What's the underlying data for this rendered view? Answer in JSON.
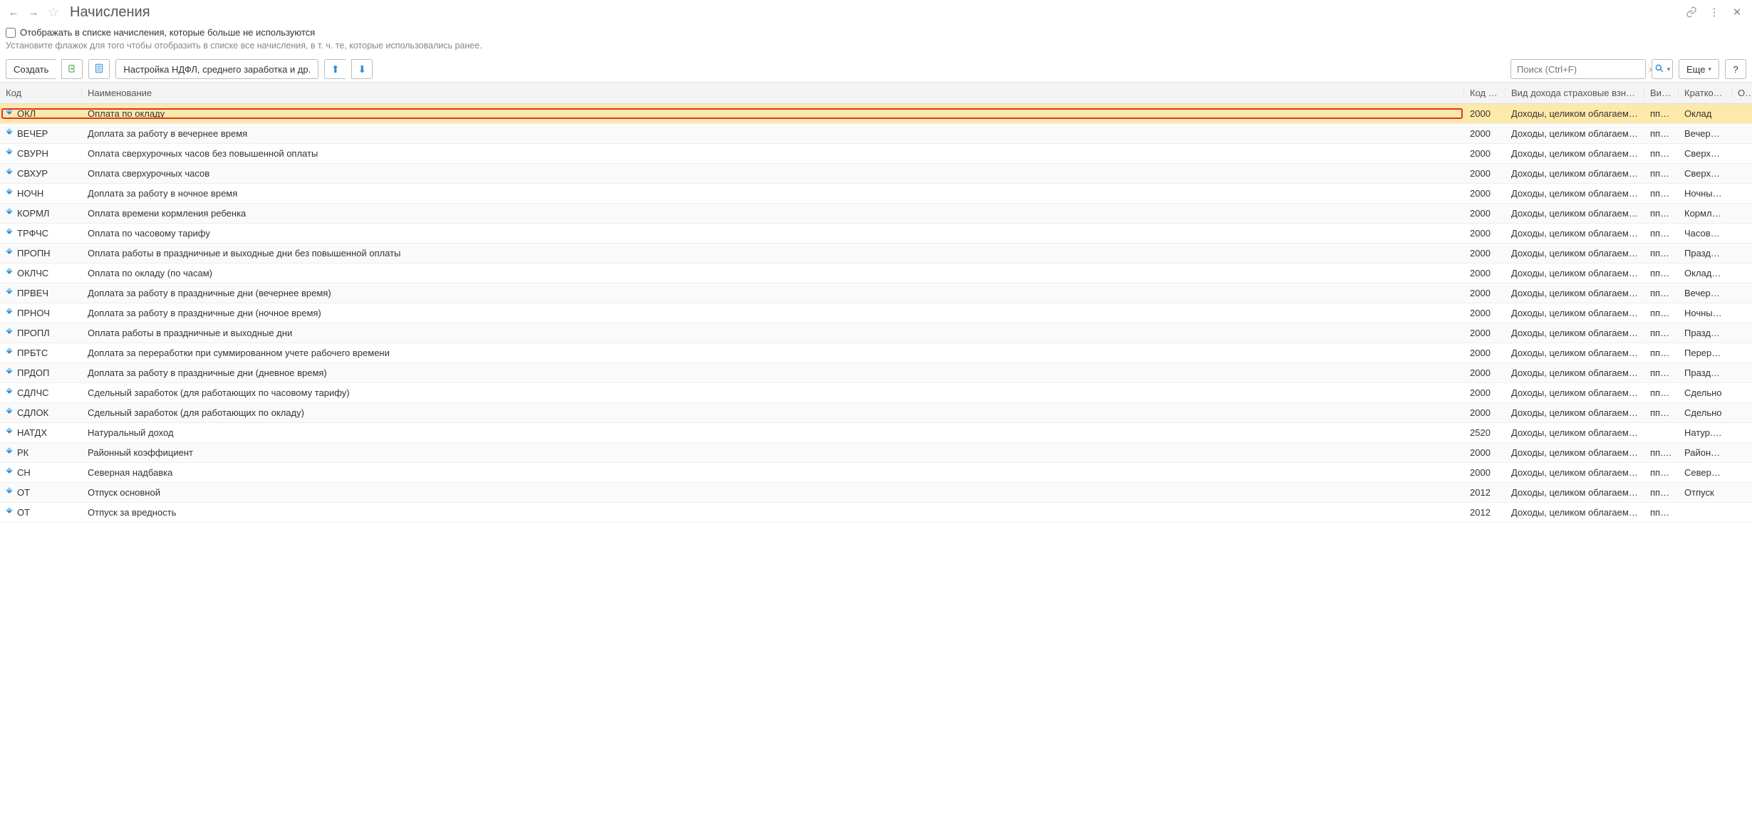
{
  "header": {
    "title": "Начисления"
  },
  "checkbox": {
    "label": "Отображать в списке начисления, которые больше не используются"
  },
  "hint": "Установите флажок для того чтобы отобразить в списке все начисления, в т. ч. те, которые использовались ранее.",
  "toolbar": {
    "create": "Создать",
    "settings": "Настройка НДФЛ, среднего заработка и др.",
    "more": "Еще",
    "search_placeholder": "Поиск (Ctrl+F)"
  },
  "columns": {
    "code": "Код",
    "name": "Наименование",
    "kod2": "Код …",
    "income": "Вид дохода страховые взносы",
    "vid": "Вид…",
    "short": "Кратко…",
    "o": "О…"
  },
  "rows": [
    {
      "code": "ОКЛ",
      "name": "Оплата по окладу",
      "k": "2000",
      "inc": "Доходы, целиком облагаемы…",
      "v": "пп…",
      "s": "Оклад",
      "selected": true,
      "highlight": true
    },
    {
      "code": "ВЕЧЕР",
      "name": "Доплата за работу в вечернее время",
      "k": "2000",
      "inc": "Доходы, целиком облагаемы…",
      "v": "пп…",
      "s": "Вечер…"
    },
    {
      "code": "СВУРН",
      "name": "Оплата сверхурочных часов без повышенной оплаты",
      "k": "2000",
      "inc": "Доходы, целиком облагаемы…",
      "v": "пп…",
      "s": "Сверх…"
    },
    {
      "code": "СВХУР",
      "name": "Оплата сверхурочных часов",
      "k": "2000",
      "inc": "Доходы, целиком облагаемы…",
      "v": "пп…",
      "s": "Сверх…"
    },
    {
      "code": "НОЧН",
      "name": "Доплата за работу в ночное время",
      "k": "2000",
      "inc": "Доходы, целиком облагаемы…",
      "v": "пп…",
      "s": "Ночны…"
    },
    {
      "code": "КОРМЛ",
      "name": "Оплата времени кормления ребенка",
      "k": "2000",
      "inc": "Доходы, целиком облагаемы…",
      "v": "пп…",
      "s": "Кормл…"
    },
    {
      "code": "ТРФЧС",
      "name": "Оплата по часовому тарифу",
      "k": "2000",
      "inc": "Доходы, целиком облагаемы…",
      "v": "пп…",
      "s": "Часов…"
    },
    {
      "code": "ПРОПН",
      "name": "Оплата работы в праздничные и выходные дни без повышенной оплаты",
      "k": "2000",
      "inc": "Доходы, целиком облагаемы…",
      "v": "пп…",
      "s": "Празд…"
    },
    {
      "code": "ОКЛЧС",
      "name": "Оплата по окладу (по часам)",
      "k": "2000",
      "inc": "Доходы, целиком облагаемы…",
      "v": "пп…",
      "s": "Оклад…"
    },
    {
      "code": "ПРВЕЧ",
      "name": "Доплата за работу в праздничные дни (вечернее время)",
      "k": "2000",
      "inc": "Доходы, целиком облагаемы…",
      "v": "пп…",
      "s": "Вечер…"
    },
    {
      "code": "ПРНОЧ",
      "name": "Доплата за работу в праздничные дни (ночное время)",
      "k": "2000",
      "inc": "Доходы, целиком облагаемы…",
      "v": "пп…",
      "s": "Ночны…"
    },
    {
      "code": "ПРОПЛ",
      "name": "Оплата работы в праздничные и выходные дни",
      "k": "2000",
      "inc": "Доходы, целиком облагаемы…",
      "v": "пп…",
      "s": "Празд…"
    },
    {
      "code": "ПРБТС",
      "name": "Доплата за переработки при суммированном учете рабочего времени",
      "k": "2000",
      "inc": "Доходы, целиком облагаемы…",
      "v": "пп…",
      "s": "Перер…"
    },
    {
      "code": "ПРДОП",
      "name": "Доплата за работу в праздничные дни (дневное время)",
      "k": "2000",
      "inc": "Доходы, целиком облагаемы…",
      "v": "пп…",
      "s": "Празд…"
    },
    {
      "code": "СДЛЧС",
      "name": "Сдельный заработок (для работающих по часовому тарифу)",
      "k": "2000",
      "inc": "Доходы, целиком облагаемы…",
      "v": "пп…",
      "s": "Сдельно"
    },
    {
      "code": "СДЛОК",
      "name": "Сдельный заработок (для работающих по окладу)",
      "k": "2000",
      "inc": "Доходы, целиком облагаемы…",
      "v": "пп…",
      "s": "Сдельно"
    },
    {
      "code": "НАТДХ",
      "name": "Натуральный доход",
      "k": "2520",
      "inc": "Доходы, целиком облагаемы…",
      "v": "",
      "s": "Натур.…"
    },
    {
      "code": "РК",
      "name": "Районный коэффициент",
      "k": "2000",
      "inc": "Доходы, целиком облагаемы…",
      "v": "пп.1…",
      "s": "Район…"
    },
    {
      "code": "СН",
      "name": "Северная надбавка",
      "k": "2000",
      "inc": "Доходы, целиком облагаемы…",
      "v": "пп…",
      "s": "Север…"
    },
    {
      "code": "ОТ",
      "name": "Отпуск основной",
      "k": "2012",
      "inc": "Доходы, целиком облагаемы…",
      "v": "пп…",
      "s": "Отпуск"
    },
    {
      "code": "ОТ",
      "name": "Отпуск за вредность",
      "k": "2012",
      "inc": "Доходы, целиком облагаемы…",
      "v": "пп…",
      "s": ""
    }
  ]
}
